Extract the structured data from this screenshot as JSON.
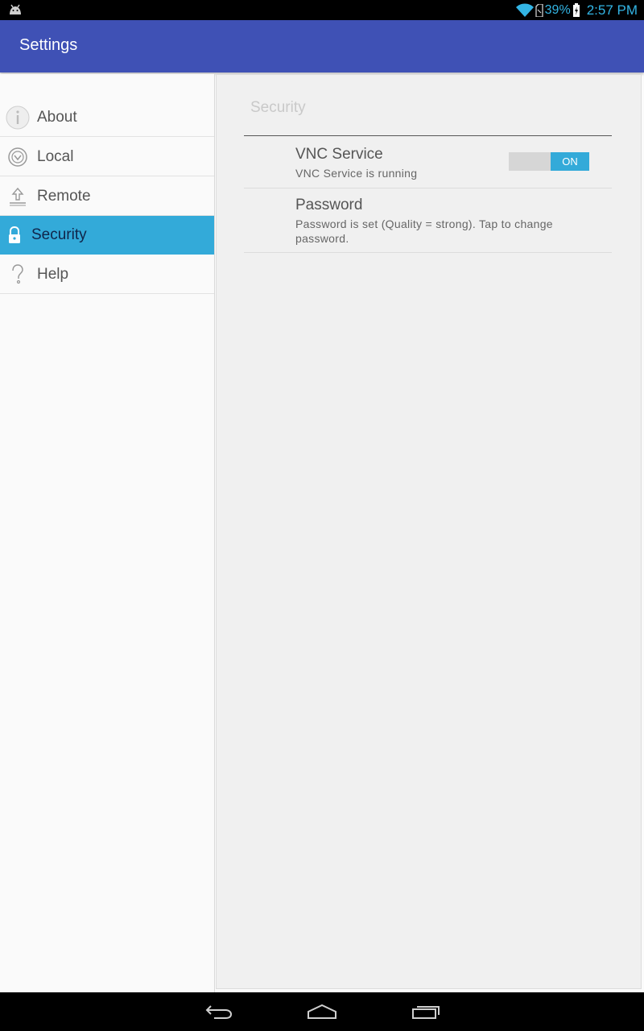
{
  "status_bar": {
    "battery": "39%",
    "time": "2:57 PM",
    "icons": [
      "android-icon",
      "wifi-icon",
      "sim-icon",
      "battery-charging-icon"
    ],
    "accent": "#33b5e5"
  },
  "app_bar": {
    "title": "Settings",
    "color": "#3f51b5"
  },
  "sidebar": {
    "items": [
      {
        "label": "About",
        "icon": "info-icon",
        "active": false
      },
      {
        "label": "Local",
        "icon": "local-icon",
        "active": false
      },
      {
        "label": "Remote",
        "icon": "upload-icon",
        "active": false
      },
      {
        "label": "Security",
        "icon": "lock-icon",
        "active": true
      },
      {
        "label": "Help",
        "icon": "help-icon",
        "active": false
      }
    ],
    "active_color": "#33aad9"
  },
  "content": {
    "section_title": "Security",
    "preferences": [
      {
        "title": "VNC Service",
        "summary": "VNC Service is running",
        "switch": {
          "state": "ON"
        }
      },
      {
        "title": "Password",
        "summary": "Password is set (Quality = strong). Tap to change password."
      }
    ]
  },
  "nav_bar": {
    "buttons": [
      "back-icon",
      "home-icon",
      "recents-icon"
    ]
  }
}
